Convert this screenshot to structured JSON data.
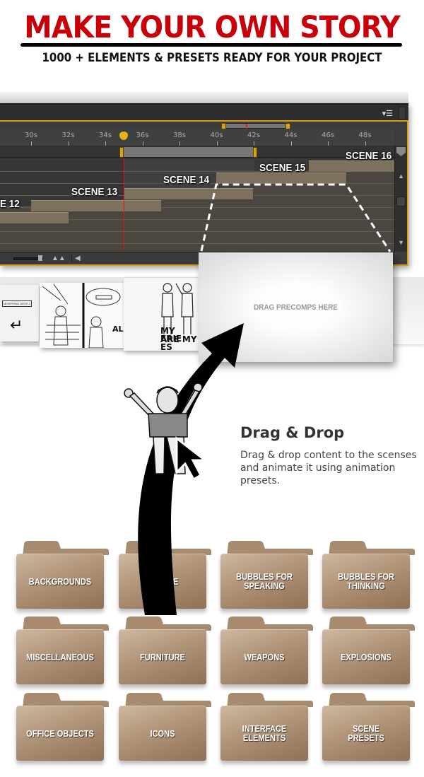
{
  "header": {
    "title": "MAKE YOUR OWN STORY",
    "subtitle": "1000 + ELEMENTS & PRESETS READY FOR YOUR PROJECT",
    "title_color": "#c8000a"
  },
  "timeline": {
    "accent_color": "#d99b18",
    "playhead_color": "#e21616",
    "panel_menu_icon": "panel-menu-icon",
    "ruler_ticks": [
      "30s",
      "32s",
      "34s",
      "36s",
      "38s",
      "40s",
      "42s",
      "44s",
      "46s",
      "48s"
    ],
    "scenes": [
      {
        "label": "E 12"
      },
      {
        "label": "SCENE 13"
      },
      {
        "label": "SCENE 14"
      },
      {
        "label": "SCENE 15"
      },
      {
        "label": "SCENE 16"
      }
    ],
    "footer_icons": [
      "zoom-slider",
      "mountain-icon",
      "scroll-left-icon"
    ]
  },
  "thumbnails": [
    {
      "tag": "MORPHING DROP 2"
    },
    {
      "text": "ALL"
    },
    {
      "text_line1": "MY FRIE",
      "text_line2": "ARE MY ES"
    }
  ],
  "drop_zone": {
    "label": "DRAG PRECOMPS HERE"
  },
  "drag_drop": {
    "title": "Drag & Drop",
    "description": "Drag & drop content to the scenses and animate it using animation presets."
  },
  "folders": [
    {
      "label": "BACKGROUNDS"
    },
    {
      "label": "PEOPLE"
    },
    {
      "label": "BUBBLES FOR\nSPEAKING"
    },
    {
      "label": "BUBBLES FOR\nTHINKING"
    },
    {
      "label": "MISCELLANEOUS"
    },
    {
      "label": "FURNITURE"
    },
    {
      "label": "WEAPONS"
    },
    {
      "label": "EXPLOSIONS"
    },
    {
      "label": "OFFICE OBJECTS"
    },
    {
      "label": "ICONS"
    },
    {
      "label": "INTERFACE\nELEMENTS"
    },
    {
      "label": "SCENE\nPRESETS"
    }
  ]
}
